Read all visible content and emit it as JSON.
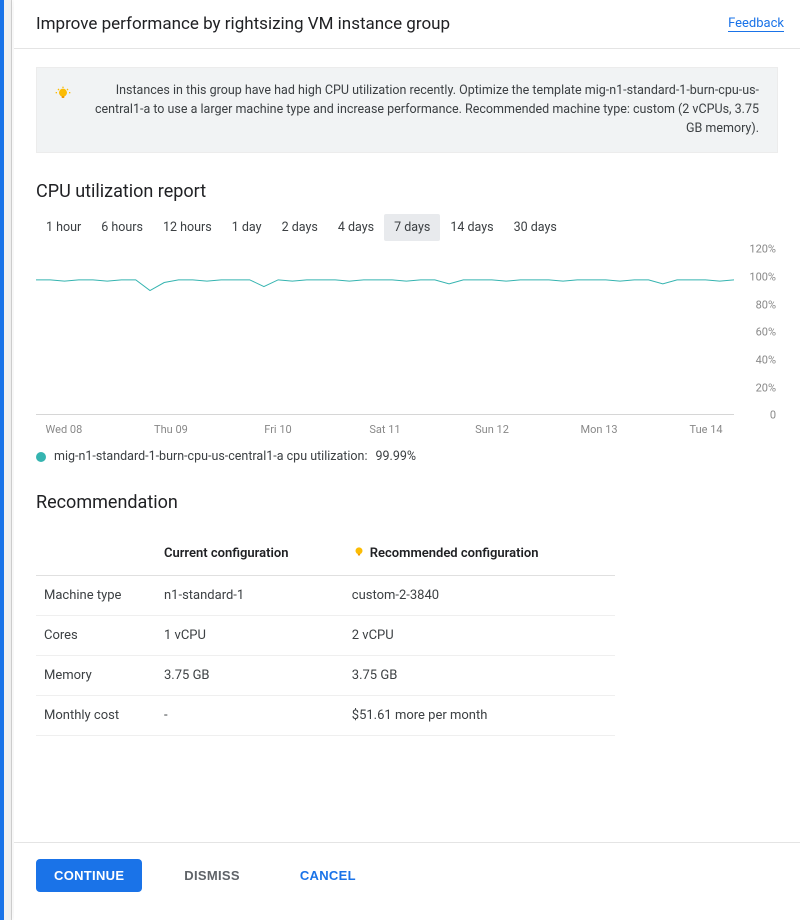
{
  "header": {
    "title": "Improve performance by rightsizing VM instance group",
    "feedback": "Feedback"
  },
  "notice": {
    "text": "Instances in this group have had high CPU utilization recently. Optimize the template mig-n1-standard-1-burn-cpu-us-central1-a to use a larger machine type and increase performance. Recommended machine type: custom (2 vCPUs, 3.75 GB memory)."
  },
  "report": {
    "title": "CPU utilization report",
    "ranges": [
      "1 hour",
      "6 hours",
      "12 hours",
      "1 day",
      "2 days",
      "4 days",
      "7 days",
      "14 days",
      "30 days"
    ],
    "selected_range": "7 days",
    "legend_label": "mig-n1-standard-1-burn-cpu-us-central1-a cpu utilization:",
    "legend_value": "99.99%"
  },
  "recommendation": {
    "title": "Recommendation",
    "col_current": "Current configuration",
    "col_recommended": "Recommended configuration",
    "rows": [
      {
        "label": "Machine type",
        "current": "n1-standard-1",
        "recommended": "custom-2-3840"
      },
      {
        "label": "Cores",
        "current": "1 vCPU",
        "recommended": "2 vCPU"
      },
      {
        "label": "Memory",
        "current": "3.75 GB",
        "recommended": "3.75 GB"
      },
      {
        "label": "Monthly cost",
        "current": "-",
        "recommended": "$51.61 more per month"
      }
    ]
  },
  "actions": {
    "continue": "CONTINUE",
    "dismiss": "DISMISS",
    "cancel": "CANCEL"
  },
  "chart_data": {
    "type": "line",
    "title": "CPU utilization report",
    "xlabel": "",
    "ylabel": "",
    "ylim": [
      0,
      120
    ],
    "y_ticks": [
      0,
      20,
      40,
      60,
      80,
      100,
      120
    ],
    "y_tick_labels": [
      "0",
      "20%",
      "40%",
      "60%",
      "80%",
      "100%",
      "120%"
    ],
    "categories": [
      "Wed 08",
      "Thu 09",
      "Fri 10",
      "Sat 11",
      "Sun 12",
      "Mon 13",
      "Tue 14"
    ],
    "series": [
      {
        "name": "mig-n1-standard-1-burn-cpu-us-central1-a cpu utilization",
        "color": "#35b4b0",
        "values": [
          99.99,
          99.99,
          99.99,
          99.99,
          99.99,
          99.99,
          99.99
        ]
      }
    ],
    "x": [
      0,
      1,
      2,
      3,
      4,
      5,
      6,
      7,
      8,
      9,
      10,
      11,
      12,
      13,
      14,
      15,
      16,
      17,
      18,
      19,
      20,
      21,
      22,
      23,
      24,
      25,
      26,
      27,
      28,
      29,
      30,
      31,
      32,
      33,
      34,
      35,
      36,
      37,
      38,
      39,
      40,
      41,
      42,
      43,
      44,
      45,
      46,
      47,
      48,
      49
    ],
    "y": [
      100,
      100,
      99,
      100,
      100,
      99,
      100,
      100,
      92,
      98,
      100,
      100,
      99,
      100,
      100,
      100,
      95,
      100,
      99,
      100,
      100,
      100,
      99,
      100,
      100,
      100,
      99,
      100,
      100,
      97,
      100,
      100,
      100,
      99,
      100,
      100,
      100,
      99,
      100,
      100,
      100,
      99,
      100,
      100,
      97,
      100,
      100,
      100,
      99,
      100
    ]
  }
}
